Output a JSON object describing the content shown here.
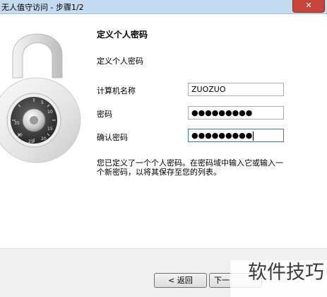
{
  "window": {
    "title": "无人值守访问 - 步骤1/2",
    "close_label": "✕"
  },
  "main": {
    "heading": "定义个人密码",
    "subheading": "定义个人密码",
    "form": {
      "computer_name_label": "计算机名称",
      "computer_name_value": "ZUOZUO",
      "password_label": "密码",
      "password_value": "●●●●●●●●●",
      "confirm_label": "确认密码",
      "confirm_value": "●●●●●●●●●"
    },
    "description": "您已定义了一个个人密码。在密码域中输入它或输入一个新密码，以将其保存至您的列表。"
  },
  "footer": {
    "back_label": "< 返回",
    "next_label": "下一"
  },
  "watermark": "软件技巧",
  "icons": {
    "padlock": "combination-padlock-icon",
    "close": "close-icon"
  }
}
